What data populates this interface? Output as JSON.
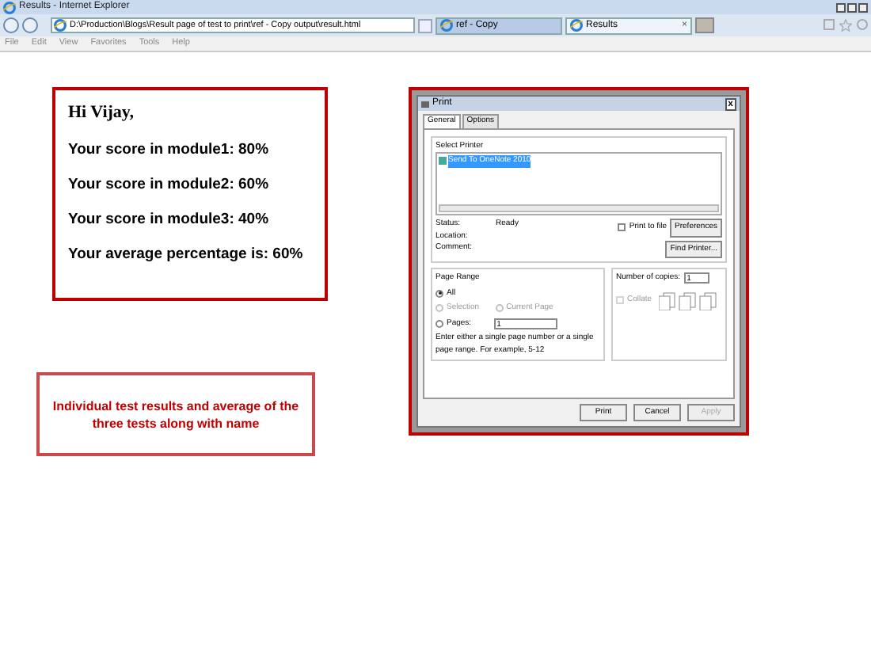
{
  "window": {
    "title": "Results - Internet Explorer"
  },
  "address": "D:\\Production\\Blogs\\Result page of test to print\\ref - Copy output\\result.html",
  "tabs": [
    {
      "label": "ref - Copy",
      "selected": false
    },
    {
      "label": "Results",
      "selected": true
    }
  ],
  "tab_close": "×",
  "menu": [
    "File",
    "Edit",
    "View",
    "Favorites",
    "Tools",
    "Help"
  ],
  "result": {
    "greeting": "Hi Vijay,",
    "lines": [
      "Your score in module1: 80%",
      "Your score in module2: 60%",
      "Your score in module3: 40%",
      "Your average percentage is: 60%"
    ]
  },
  "note": "Individual test results and average of the three tests along with name",
  "print_dialog": {
    "title": "Print",
    "close": "x",
    "tabs": [
      {
        "label": "General",
        "selected": true
      },
      {
        "label": "Options",
        "selected": false
      }
    ],
    "printer_group": "Select Printer",
    "printers": [
      {
        "label": "Send To OneNote 2010",
        "selected": true
      }
    ],
    "status": [
      {
        "label": "Status:",
        "value": "Ready"
      },
      {
        "label": "Location:"
      },
      {
        "label": "Comment:"
      }
    ],
    "print_to_file": {
      "label": "Print to file",
      "checked": false
    },
    "preferences": "Preferences",
    "find_printer": "Find Printer...",
    "range_group": "Page Range",
    "ranges": [
      {
        "label": "All",
        "selected": true,
        "disabled": false
      },
      {
        "label": "Selection",
        "selected": false,
        "disabled": true
      },
      {
        "label": "Current Page",
        "selected": false,
        "disabled": true
      },
      {
        "label": "Pages:",
        "selected": false,
        "disabled": false
      }
    ],
    "pages_value": "1",
    "help": "Enter either a single page number or a single page range.  For example, 5-12",
    "copies_label": "Number of copies:",
    "copies_value": "1",
    "collate": {
      "label": "Collate",
      "checked": false,
      "disabled": true
    },
    "buttons": [
      {
        "label": "Print",
        "disabled": false
      },
      {
        "label": "Cancel",
        "disabled": false
      },
      {
        "label": "Apply",
        "disabled": true
      }
    ]
  }
}
